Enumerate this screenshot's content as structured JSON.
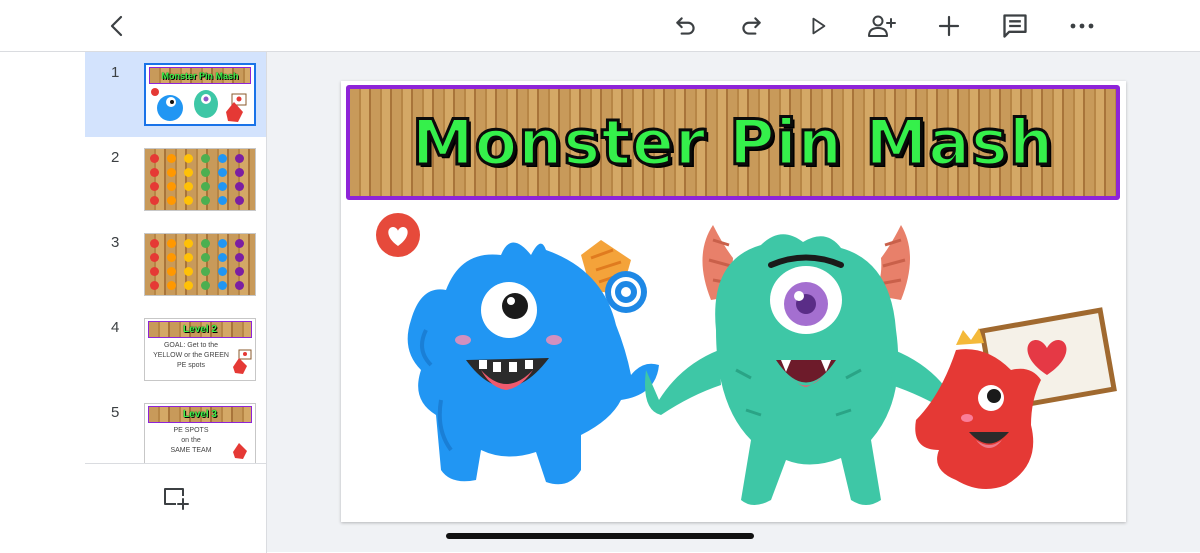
{
  "slides": [
    {
      "number": "1",
      "title": "Monster Pin Mash"
    },
    {
      "number": "2"
    },
    {
      "number": "3"
    },
    {
      "number": "4",
      "title": "Level 2",
      "text_lines": [
        "GOAL: Get to the",
        "YELLOW or the GREEN",
        "PE spots"
      ]
    },
    {
      "number": "5",
      "title": "Level 3",
      "text_lines": [
        "PE SPOTS",
        "on the",
        "SAME TEAM"
      ]
    }
  ],
  "main_slide": {
    "title": "Monster Pin Mash"
  },
  "colors": {
    "accent_selected": "#d3e3fd",
    "title_green": "#35f04b",
    "banner_border": "#8e24d8",
    "blue_monster": "#2196f3",
    "teal_monster": "#3ec7a6",
    "red_monster": "#e53935"
  },
  "icons": [
    "back-icon",
    "undo-icon",
    "redo-icon",
    "play-icon",
    "share-icon",
    "add-icon",
    "comment-icon",
    "more-icon",
    "new-slide-icon"
  ]
}
